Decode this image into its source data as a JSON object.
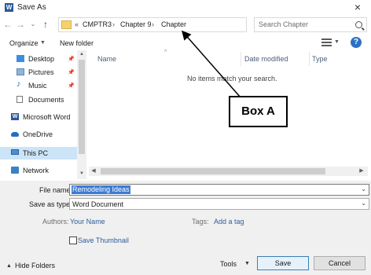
{
  "window": {
    "title": "Save As",
    "app_icon_letter": "W",
    "close_symbol": "×"
  },
  "nav": {
    "back": "←",
    "forward": "→",
    "recent": "⌄",
    "up": "↑",
    "refresh": "↻"
  },
  "address": {
    "prefix": "«",
    "crumbs": [
      "CMPTR3",
      "Chapter 9",
      "Chapter"
    ],
    "separator": "›",
    "dropdown": "⌄"
  },
  "search": {
    "placeholder": "Search Chapter"
  },
  "toolbar": {
    "organize_label": "Organize",
    "organize_chev": "▼",
    "new_folder_label": "New folder",
    "view_chev": "▼",
    "help_symbol": "?"
  },
  "sidebar": {
    "items": [
      {
        "label": "Desktop",
        "icon": "desktop-icon",
        "pinned": true
      },
      {
        "label": "Pictures",
        "icon": "pictures-icon",
        "pinned": true
      },
      {
        "label": "Music",
        "icon": "music-icon",
        "pinned": true
      },
      {
        "label": "Documents",
        "icon": "documents-icon",
        "pinned": false
      },
      {
        "label": "Microsoft Word",
        "icon": "word-icon",
        "pinned": false
      },
      {
        "label": "OneDrive",
        "icon": "onedrive-icon",
        "pinned": false
      },
      {
        "label": "This PC",
        "icon": "this-pc-icon",
        "pinned": false,
        "selected": true
      },
      {
        "label": "Network",
        "icon": "network-icon",
        "pinned": false
      }
    ],
    "pin_symbol": "📌",
    "scroll_up": "▲",
    "scroll_down": "▼"
  },
  "content": {
    "columns": [
      "Name",
      "Date modified",
      "Type"
    ],
    "sort_caret": "^",
    "empty_message": "No items match your search.",
    "hscroll_left": "◀",
    "hscroll_right": "▶"
  },
  "form": {
    "file_name_label": "File name:",
    "file_name_value": "Remodeling Ideas",
    "save_type_label": "Save as type:",
    "save_type_value": "Word Document",
    "dropdown_chev": "⌄",
    "authors_label": "Authors:",
    "authors_value": "Your Name",
    "tags_label": "Tags:",
    "tags_value": "Add a tag",
    "save_thumbnail_label": "Save Thumbnail"
  },
  "footer": {
    "hide_chev": "▲",
    "hide_folders_label": "Hide Folders",
    "tools_label": "Tools",
    "tools_chev": "▼",
    "save_label": "Save",
    "cancel_label": "Cancel"
  },
  "annotation": {
    "box_label": "Box A"
  },
  "colors": {
    "selection_bg": "#cce4f7",
    "link_blue": "#2e5d9c",
    "help_blue": "#2e70c4",
    "word_blue": "#2b579a",
    "folder_yellow": "#f4d36e"
  }
}
